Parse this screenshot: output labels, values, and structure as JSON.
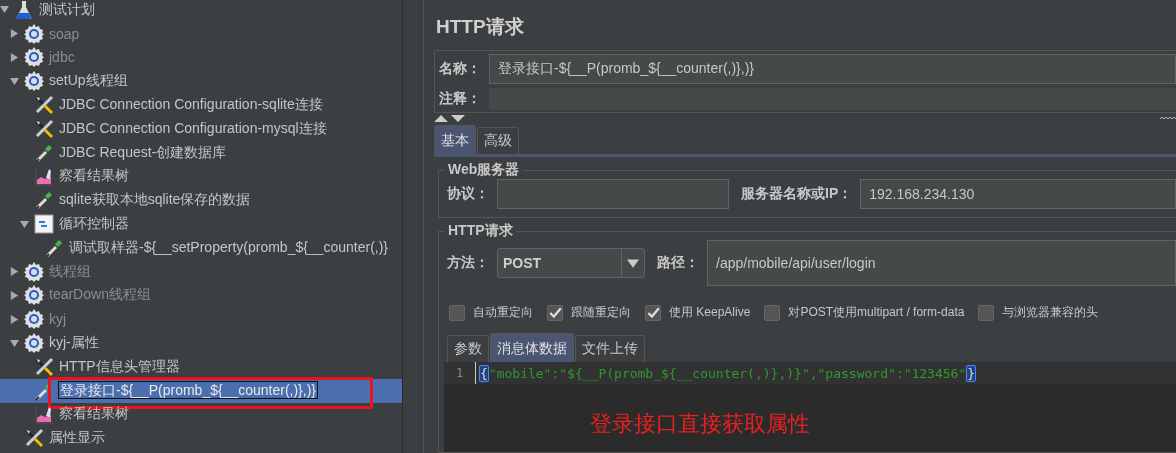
{
  "tree": [
    {
      "label": "测试计划",
      "kind": "test-plan",
      "disabled": false,
      "selected": false,
      "annotated": false,
      "expanded": true,
      "children": [
        {
          "label": "soap",
          "kind": "thread-group",
          "disabled": true,
          "selected": false,
          "annotated": false,
          "expanded": false
        },
        {
          "label": "jdbc",
          "kind": "thread-group",
          "disabled": true,
          "selected": false,
          "annotated": false,
          "expanded": false
        },
        {
          "label": "setUp线程组",
          "kind": "thread-group",
          "disabled": false,
          "selected": false,
          "annotated": false,
          "expanded": true,
          "children": [
            {
              "label": "JDBC Connection Configuration-sqlite连接",
              "kind": "config",
              "disabled": false,
              "selected": false,
              "annotated": false
            },
            {
              "label": "JDBC Connection Configuration-mysql连接",
              "kind": "config",
              "disabled": false,
              "selected": false,
              "annotated": false
            },
            {
              "label": "JDBC Request-创建数据库",
              "kind": "sampler",
              "disabled": false,
              "selected": false,
              "annotated": false
            },
            {
              "label": "察看结果树",
              "kind": "listener",
              "disabled": false,
              "selected": false,
              "annotated": false
            },
            {
              "label": "sqlite获取本地sqlite保存的数据",
              "kind": "sampler",
              "disabled": false,
              "selected": false,
              "annotated": false
            },
            {
              "label": "循环控制器",
              "kind": "controller",
              "disabled": false,
              "selected": false,
              "annotated": false,
              "expanded": true,
              "children": [
                {
                  "label": "调试取样器-${__setProperty(promb_${__counter(,)}",
                  "kind": "sampler",
                  "disabled": false,
                  "selected": false,
                  "annotated": false
                }
              ]
            }
          ]
        },
        {
          "label": "线程组",
          "kind": "thread-group",
          "disabled": true,
          "selected": false,
          "annotated": false,
          "expanded": false
        },
        {
          "label": "tearDown线程组",
          "kind": "thread-group",
          "disabled": true,
          "selected": false,
          "annotated": false,
          "expanded": false
        },
        {
          "label": "kyj",
          "kind": "thread-group",
          "disabled": true,
          "selected": false,
          "annotated": false,
          "expanded": false
        },
        {
          "label": "kyj-属性",
          "kind": "thread-group",
          "disabled": false,
          "selected": false,
          "annotated": false,
          "expanded": true,
          "children": [
            {
              "label": "HTTP信息头管理器",
              "kind": "config",
              "disabled": false,
              "selected": false,
              "annotated": false
            },
            {
              "label": "登录接口-${__P(promb_${__counter(,)},)}",
              "kind": "sampler",
              "disabled": false,
              "selected": true,
              "annotated": true
            },
            {
              "label": "察看结果树",
              "kind": "listener",
              "disabled": false,
              "selected": false,
              "annotated": false
            }
          ]
        },
        {
          "label": "属性显示",
          "kind": "config",
          "disabled": false,
          "selected": false,
          "annotated": false
        }
      ]
    }
  ],
  "panel": {
    "title": "HTTP请求",
    "name_label": "名称：",
    "name_value": "登录接口-${__P(promb_${__counter(,)},)}",
    "comment_label": "注释：",
    "tabs": [
      {
        "label": "基本",
        "selected": true
      },
      {
        "label": "高级",
        "selected": false
      }
    ],
    "web_server": {
      "title": "Web服务器",
      "protocol_label": "协议：",
      "server_label": "服务器名称或IP：",
      "server_value": "192.168.234.130"
    },
    "http_request": {
      "title": "HTTP请求",
      "method_label": "方法：",
      "method_value": "POST",
      "path_label": "路径：",
      "path_value": "/app/mobile/api/user/login",
      "options": [
        {
          "label": "自动重定向",
          "checked": false
        },
        {
          "label": "跟随重定向",
          "checked": true
        },
        {
          "label": "使用 KeepAlive",
          "checked": true
        },
        {
          "label": "对POST使用multipart / form-data",
          "checked": false
        },
        {
          "label": "与浏览器兼容的头",
          "checked": false
        }
      ]
    },
    "body_tabs": [
      {
        "label": "参数",
        "selected": false
      },
      {
        "label": "消息体数据",
        "selected": true
      },
      {
        "label": "文件上传",
        "selected": false
      }
    ],
    "editor": {
      "line_number": "1",
      "code": "{\"mobile\":\"${__P(promb_${__counter(,)},)}\",\"password\":\"123456\"}"
    },
    "annotation": "登录接口直接获取属性"
  }
}
